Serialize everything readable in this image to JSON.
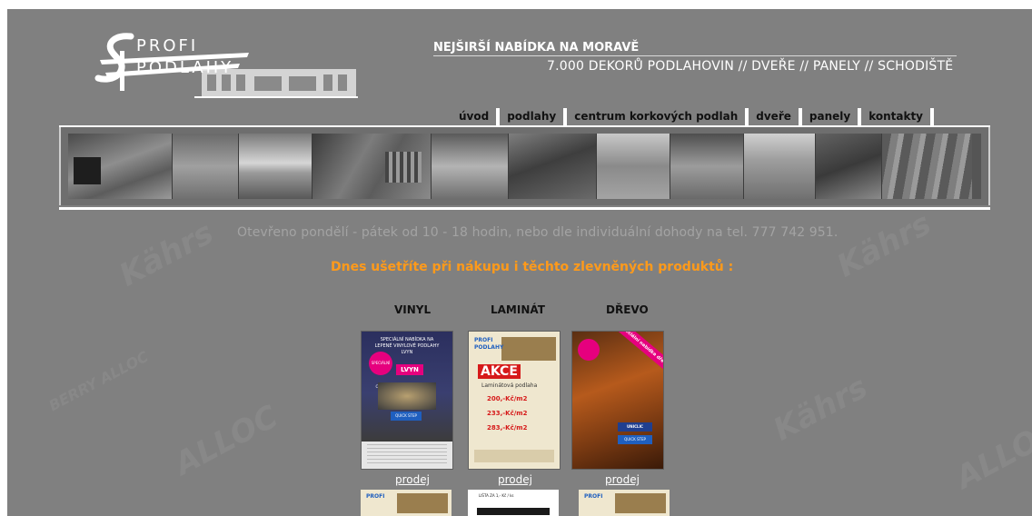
{
  "brand": {
    "line1": "PROFI",
    "line2": "PODLAHY"
  },
  "header": {
    "tagline": "NEJŠIRŠÍ NABÍDKA NA MORAVĚ",
    "subtitle": "7.000 DEKORŮ PODLAHOVIN // DVEŘE // PANELY // SCHODIŠTĚ"
  },
  "nav": {
    "items": [
      "úvod",
      "podlahy",
      "centrum korkových podlah",
      "dveře",
      "panely",
      "kontakty"
    ]
  },
  "watermarks": [
    "Kährs",
    "ALLOC",
    "Kährs",
    "ALLOC",
    "BERRY ALLOC",
    "Kährs"
  ],
  "content": {
    "opening": "Otevřeno pondělí - pátek od 10 - 18 hodin, nebo dle individuální dohody na tel. 777 742 951.",
    "promo": "Dnes ušetříte při nákupu i těchto zlevněných produktů :",
    "categories": [
      "VINYL",
      "LAMINÁT",
      "DŘEVO"
    ],
    "link_label": "prodej"
  },
  "posters": {
    "vinyl": {
      "heading": "SPECIÁLNÍ NABÍDKA NA LEPENÉ VINYLOVÉ PODLAHY LVYN",
      "badge": "SPECIÁLNÍ CENA",
      "brand": "LVYN",
      "logo": "QUICK STEP"
    },
    "laminate": {
      "brand1": "PROFI",
      "brand2": "PODLAHY",
      "akce": "AKCE",
      "subtitle": "Laminátová podlaha",
      "prices": [
        "200,-Kč/m2",
        "233,-Kč/m2",
        "283,-Kč/m2"
      ]
    },
    "wood": {
      "ribbon": "Speciální nabídka dřevěné podlahy",
      "logo1": "UNICLIC",
      "logo2": "QUICK STEP"
    }
  },
  "thumbs": {
    "mid": "LIŠTA ZA 1,- Kč / ks"
  },
  "colors": {
    "background": "#808080",
    "accent": "#ff9a1a",
    "nav_text": "#111111",
    "open_text": "#a3a3a3"
  }
}
